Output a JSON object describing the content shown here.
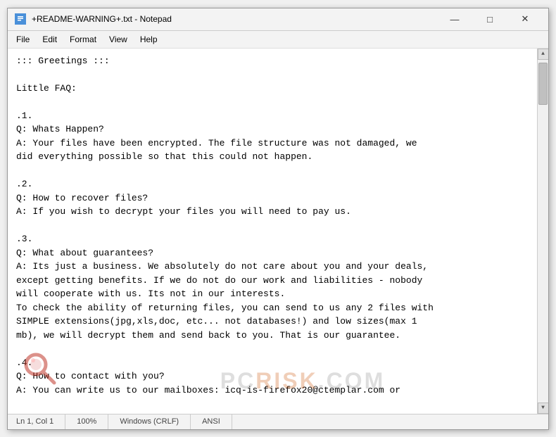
{
  "window": {
    "title": "+README-WARNING+.txt - Notepad",
    "icon_label": "notepad-icon"
  },
  "title_controls": {
    "minimize": "—",
    "maximize": "□",
    "close": "✕"
  },
  "menu": {
    "items": [
      "File",
      "Edit",
      "Format",
      "View",
      "Help"
    ]
  },
  "content": "::: Greetings :::\n\nLittle FAQ:\n\n.1.\nQ: Whats Happen?\nA: Your files have been encrypted. The file structure was not damaged, we\ndid everything possible so that this could not happen.\n\n.2.\nQ: How to recover files?\nA: If you wish to decrypt your files you will need to pay us.\n\n.3.\nQ: What about guarantees?\nA: Its just a business. We absolutely do not care about you and your deals,\nexcept getting benefits. If we do not do our work and liabilities - nobody\nwill cooperate with us. Its not in our interests.\nTo check the ability of returning files, you can send to us any 2 files with\nSIMPLE extensions(jpg,xls,doc, etc... not databases!) and low sizes(max 1\nmb), we will decrypt them and send back to you. That is our guarantee.\n\n.4.\nQ: How to contact with you?\nA: You can write us to our mailboxes: icq-is-firefox20@ctemplar.com or",
  "status_bar": {
    "ln_col": "Ln 1, Col 1",
    "zoom": "100%",
    "line_ending": "Windows (CRLF)",
    "encoding": "ANSI"
  },
  "watermark": {
    "pc": "PC",
    "separator": " ",
    "risk": "RISK",
    "domain": ".COM"
  }
}
